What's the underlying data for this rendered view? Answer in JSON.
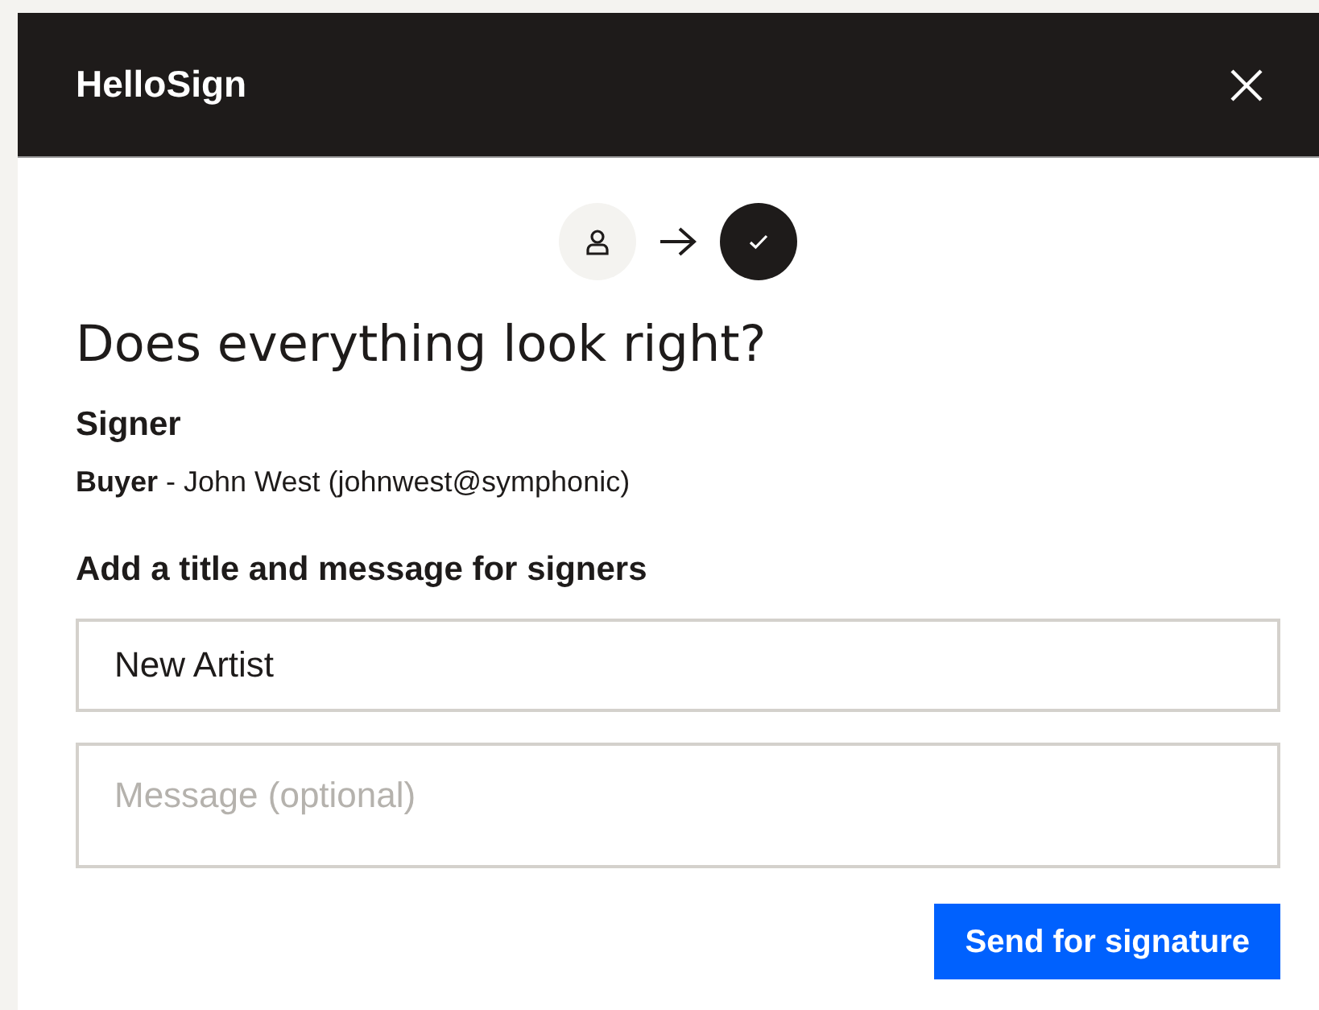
{
  "header": {
    "title": "HelloSign"
  },
  "steps": [
    {
      "kind": "person",
      "active": false
    },
    {
      "kind": "check",
      "active": true
    }
  ],
  "heading": "Does everything look right?",
  "signer": {
    "label": "Signer",
    "detail": "**Buyer** - John West (johnwest@symphonic)"
  },
  "message_section": {
    "label": "Add a title and message for signers",
    "title_value": "New Artist",
    "message_placeholder": "Message (optional)"
  },
  "buttons": [
    "Send for signature"
  ]
}
